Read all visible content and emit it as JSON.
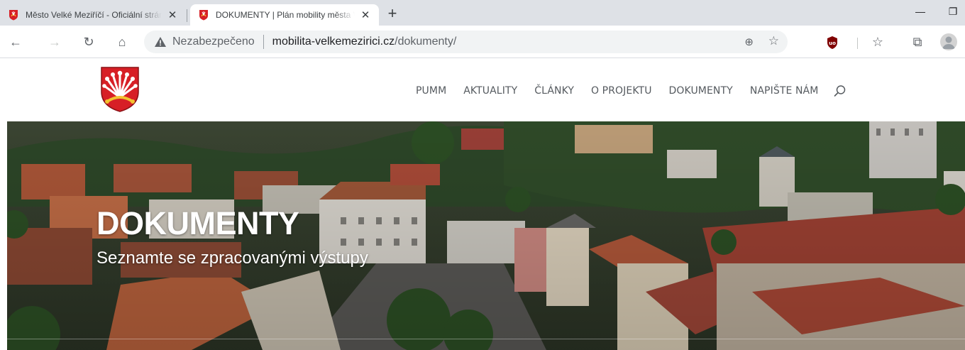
{
  "browser": {
    "tabs": [
      {
        "title": "Město Velké Meziříčí - Oficiální stránky",
        "close": "✕",
        "favicon": "city-crest-icon",
        "active": false
      },
      {
        "title": "DOKUMENTY | Plán mobility města Velké Meziříčí",
        "close": "✕",
        "favicon": "city-crest-icon",
        "active": true
      }
    ],
    "new_tab": "+",
    "window": {
      "minimize": "—",
      "restore": "❐"
    },
    "nav": {
      "back": "←",
      "forward": "→",
      "reload": "↻",
      "home": "⌂"
    },
    "omnibox": {
      "security_label": "Nezabezpečeno",
      "url_host": "mobilita-velkemezirici.cz",
      "url_path": "/dokumenty/",
      "zoom_icon": "⊕",
      "favorite_icon": "☆"
    },
    "extensions": {
      "ublock": "ublock-origin-icon",
      "favorites": "☆",
      "collections": "⧉"
    }
  },
  "site": {
    "nav_items": [
      "PUMM",
      "AKTUALITY",
      "ČLÁNKY",
      "O PROJEKTU",
      "DOKUMENTY",
      "NAPIŠTE NÁM"
    ],
    "hero_title": "DOKUMENTY",
    "hero_subtitle": "Seznamte se zpracovanými výstupy"
  },
  "colors": {
    "crest_red": "#d71f26",
    "crest_gold": "#f2c230",
    "nav_text": "#555a5f",
    "tabstrip": "#dee1e6"
  }
}
